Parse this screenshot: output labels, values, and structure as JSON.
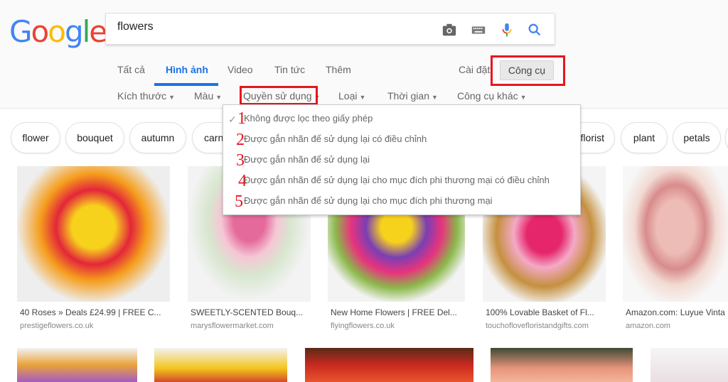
{
  "logo": "Google",
  "search": {
    "query": "flowers"
  },
  "nav": {
    "tabs": [
      "Tất cả",
      "Hình ảnh",
      "Video",
      "Tin tức",
      "Thêm"
    ],
    "active": "Hình ảnh",
    "settings": "Cài đặt",
    "tools": "Công cụ"
  },
  "filters": [
    "Kích thước",
    "Màu",
    "Quyền sử dụng",
    "Loại",
    "Thời gian",
    "Công cụ khác"
  ],
  "chips": [
    "flower",
    "bouquet",
    "autumn",
    "carn",
    "florist",
    "plant",
    "petals"
  ],
  "usage_rights_menu": {
    "selected": "Không được lọc theo giấy phép",
    "items": [
      {
        "num": "1",
        "label": "Không được lọc theo giấy phép"
      },
      {
        "num": "2",
        "label": "Được gắn nhãn để sử dụng lại có điều chỉnh"
      },
      {
        "num": "3",
        "label": "Được gắn nhãn để sử dụng lại"
      },
      {
        "num": "4",
        "label": "Được gắn nhãn để sử dụng lại cho mục đích phi thương mại có điều chỉnh"
      },
      {
        "num": "5",
        "label": "Được gắn nhãn để sử dụng lại cho mục đích phi thương mại"
      }
    ]
  },
  "results": [
    {
      "title": "40 Roses » Deals £24.99 | FREE C...",
      "domain": "prestigeflowers.co.uk"
    },
    {
      "title": "SWEETLY-SCENTED Bouq...",
      "domain": "marysflowermarket.com"
    },
    {
      "title": "New Home Flowers | FREE Del...",
      "domain": "flyingflowers.co.uk"
    },
    {
      "title": "100% Lovable Basket of Fl...",
      "domain": "touchoflovefloristandgifts.com"
    },
    {
      "title": "Amazon.com: Luyue Vinta",
      "domain": "amazon.com"
    }
  ],
  "colors": {
    "accent": "#1a73e8",
    "annotation": "#e8151d"
  }
}
